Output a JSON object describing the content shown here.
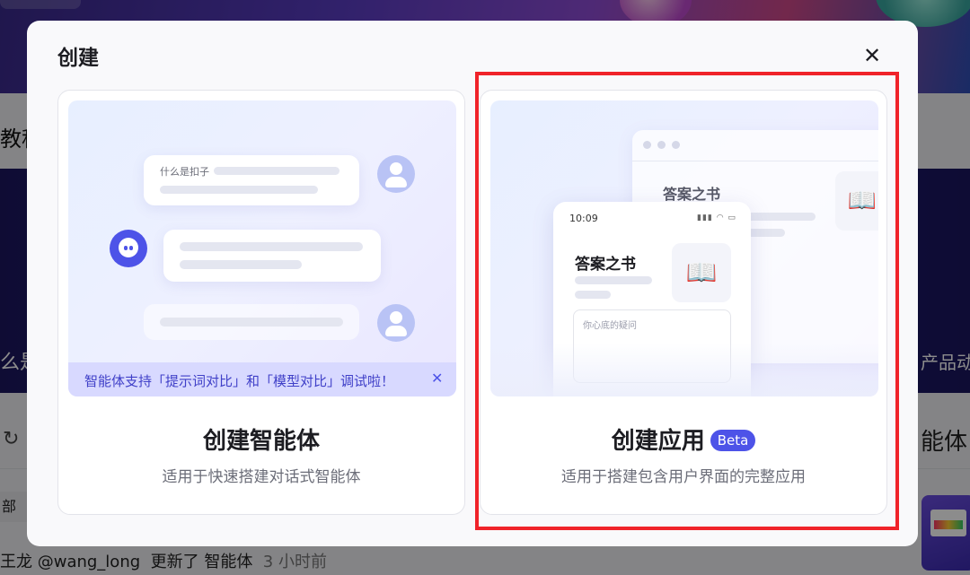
{
  "background": {
    "tutorial_fragment": "教程",
    "left_fragment": "么是",
    "right_fragment": "产品动",
    "refresh_icon": "↻",
    "agent_fragment": "能体",
    "chip_fragment": "部",
    "feed": {
      "author": "王龙 @wang_long",
      "action": "更新了 智能体",
      "time": "3 小时前"
    }
  },
  "modal": {
    "title": "创建",
    "close_icon": "✕",
    "cards": [
      {
        "title": "创建智能体",
        "description": "适用于快速搭建对话式智能体",
        "preview": {
          "question": "什么是扣子",
          "notice": "智能体支持「提示词对比」和「模型对比」调试啦！",
          "notice_close": "✕"
        }
      },
      {
        "title": "创建应用",
        "badge": "Beta",
        "description": "适用于搭建包含用户界面的完整应用",
        "highlighted": true,
        "preview": {
          "window_title": "答案之书",
          "phone_time": "10:09",
          "phone_status": "▮▮▮ ◠ ▭",
          "phone_title": "答案之书",
          "book_icon": "📖",
          "input_placeholder": "你心底的疑问"
        }
      }
    ]
  },
  "colors": {
    "accent": "#4d53e8",
    "highlight_border": "#f0232a",
    "notice_bg": "#d8d9ff"
  }
}
